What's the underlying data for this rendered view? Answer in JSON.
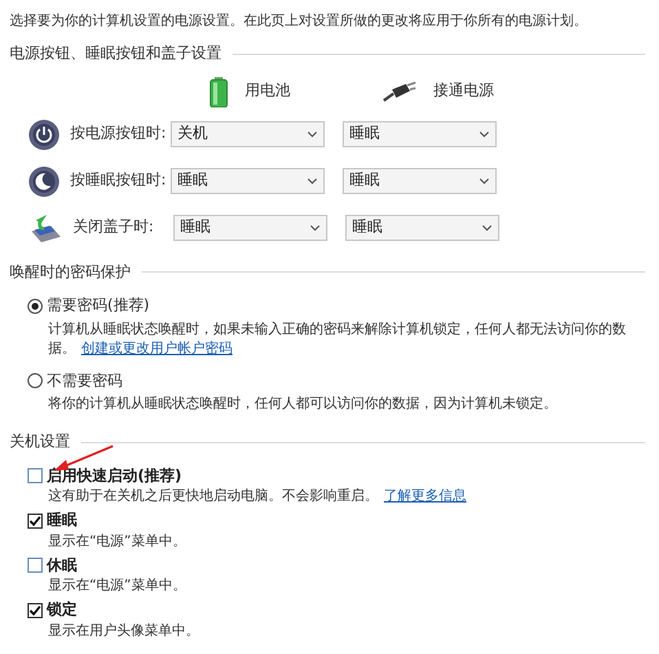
{
  "intro": "选择要为你的计算机设置的电源设置。在此页上对设置所做的更改将应用于你所有的电源计划。",
  "power_section": {
    "title": "电源按钮、睡眠按钮和盖子设置",
    "columns": [
      {
        "kind": "battery",
        "label": "用电池"
      },
      {
        "kind": "plug",
        "label": "接通电源"
      }
    ],
    "rows": [
      {
        "kind": "power",
        "label": "按电源按钮时:",
        "values": [
          "关机",
          "睡眠"
        ]
      },
      {
        "kind": "sleep",
        "label": "按睡眠按钮时:",
        "values": [
          "睡眠",
          "睡眠"
        ]
      },
      {
        "kind": "lid",
        "label": "关闭盖子时:",
        "values": [
          "睡眠",
          "睡眠"
        ]
      }
    ]
  },
  "password_section": {
    "title": "唤醒时的密码保护",
    "options": [
      {
        "label": "需要密码(推荐)",
        "selected": true,
        "description": "计算机从睡眠状态唤醒时，如果未输入正确的密码来解除计算机锁定，任何人都无法访问你的数据。",
        "link": "创建或更改用户帐户密码"
      },
      {
        "label": "不需要密码",
        "selected": false,
        "description": "将你的计算机从睡眠状态唤醒时，任何人都可以访问你的数据，因为计算机未锁定。"
      }
    ]
  },
  "shutdown_section": {
    "title": "关机设置",
    "items": [
      {
        "label": "启用快速启动(推荐)",
        "checked": false,
        "description": "这有助于在关机之后更快地启动电脑。不会影响重启。",
        "link": "了解更多信息"
      },
      {
        "label": "睡眠",
        "checked": true,
        "description": "显示在“电源”菜单中。"
      },
      {
        "label": "休眠",
        "checked": false,
        "description": "显示在“电源”菜单中。"
      },
      {
        "label": "锁定",
        "checked": true,
        "description": "显示在用户头像菜单中。"
      }
    ]
  }
}
